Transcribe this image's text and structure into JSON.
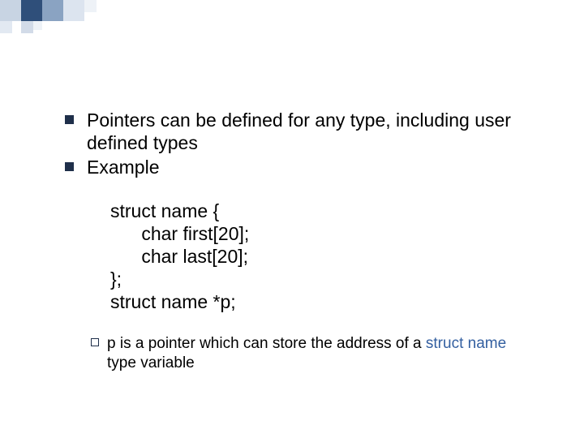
{
  "bullets": {
    "b1": "Pointers can be defined for any type, including user defined types",
    "b2": "Example"
  },
  "code": {
    "l1": "struct name {",
    "l2": "      char first[20];",
    "l3": "      char last[20];",
    "l4": "};",
    "l5": "struct name *p;"
  },
  "sub": {
    "pre": "p is a pointer which can store the address of a ",
    "kw": "struct name",
    "post": " type variable"
  }
}
